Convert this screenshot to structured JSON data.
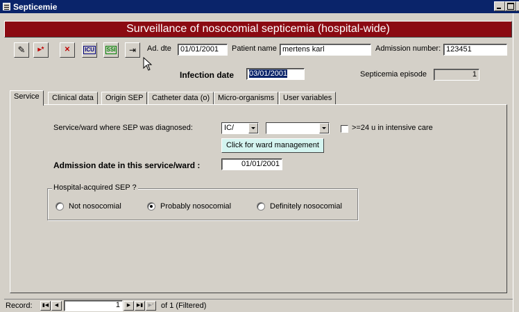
{
  "window": {
    "title": "Septicemie"
  },
  "banner": {
    "title": "Surveillance of nosocomial septicemia (hospital-wide)"
  },
  "toolbar": {
    "buttons": [
      {
        "name": "edit-record",
        "glyph": "✎"
      },
      {
        "name": "new-record",
        "glyph": "▸*"
      },
      {
        "name": "delete-record",
        "glyph": "▸✕"
      },
      {
        "name": "icu",
        "glyph": "ICU"
      },
      {
        "name": "ssi",
        "glyph": "SSI"
      },
      {
        "name": "exit",
        "glyph": "⇥"
      }
    ]
  },
  "header": {
    "ad_dte_label": "Ad. dte",
    "ad_dte_value": "01/01/2001",
    "patient_name_label": "Patient name",
    "patient_name_value": "mertens karl",
    "admission_number_label": "Admission number:",
    "admission_number_value": "123451",
    "infection_date_label": "Infection date",
    "infection_date_value": "03/01/2001",
    "septicemia_episode_label": "Septicemia episode",
    "septicemia_episode_value": "1"
  },
  "tabs": [
    {
      "label": "Service",
      "active": true
    },
    {
      "label": "Clinical data",
      "active": false
    },
    {
      "label": "Origin SEP",
      "active": false
    },
    {
      "label": "Catheter data (o)",
      "active": false
    },
    {
      "label": "Micro-organisms",
      "active": false
    },
    {
      "label": "User variables",
      "active": false
    }
  ],
  "service": {
    "ward_label": "Service/ward where SEP was diagnosed:",
    "ward_code": "IC/",
    "ward_detail": "",
    "icu_checkbox_label": ">=24 u in intensive care",
    "icu_checked": false,
    "ward_button_label": "Click for ward management",
    "admission_label": "Admission date in this service/ward :",
    "admission_value": "01/01/2001",
    "group_label": "Hospital-acquired SEP ?",
    "options": [
      {
        "label": "Not nosocomial",
        "selected": false
      },
      {
        "label": "Probably nosocomial",
        "selected": true
      },
      {
        "label": "Definitely nosocomial",
        "selected": false
      }
    ]
  },
  "navigator": {
    "record_label": "Record:",
    "current": "1",
    "of_text": "of  1 (Filtered)"
  },
  "colors": {
    "banner": "#8b0a12",
    "titlebar": "#0a246a",
    "ward_button": "#d4f4f0"
  }
}
